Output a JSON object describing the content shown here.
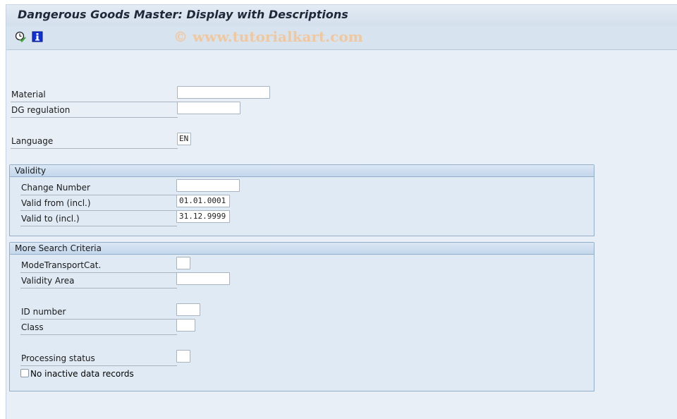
{
  "window": {
    "title": "Dangerous Goods Master: Display with Descriptions"
  },
  "toolbar": {
    "icons": [
      {
        "name": "execute-icon",
        "tooltip": "Execute"
      },
      {
        "name": "info-icon",
        "tooltip": "Information"
      }
    ],
    "watermark": "© www.tutorialkart.com"
  },
  "form": {
    "material": {
      "label": "Material",
      "value": ""
    },
    "dg_regulation": {
      "label": "DG regulation",
      "value": ""
    },
    "language": {
      "label": "Language",
      "value": "EN"
    }
  },
  "validity": {
    "title": "Validity",
    "change_number": {
      "label": "Change Number",
      "value": ""
    },
    "valid_from": {
      "label": "Valid from (incl.)",
      "value": "01.01.0001"
    },
    "valid_to": {
      "label": "Valid to (incl.)",
      "value": "31.12.9999"
    }
  },
  "more_criteria": {
    "title": "More Search Criteria",
    "mode_transport_cat": {
      "label": "ModeTransportCat.",
      "value": ""
    },
    "validity_area": {
      "label": "Validity Area",
      "value": ""
    },
    "id_number": {
      "label": "ID number",
      "value": ""
    },
    "class": {
      "label": "Class",
      "value": ""
    },
    "processing_status": {
      "label": "Processing status",
      "value": ""
    },
    "no_inactive": {
      "label": "No inactive data records",
      "checked": false
    }
  },
  "colors": {
    "background": "#e8eff7",
    "group_border": "#93aecb",
    "title_text": "#1f2838"
  }
}
